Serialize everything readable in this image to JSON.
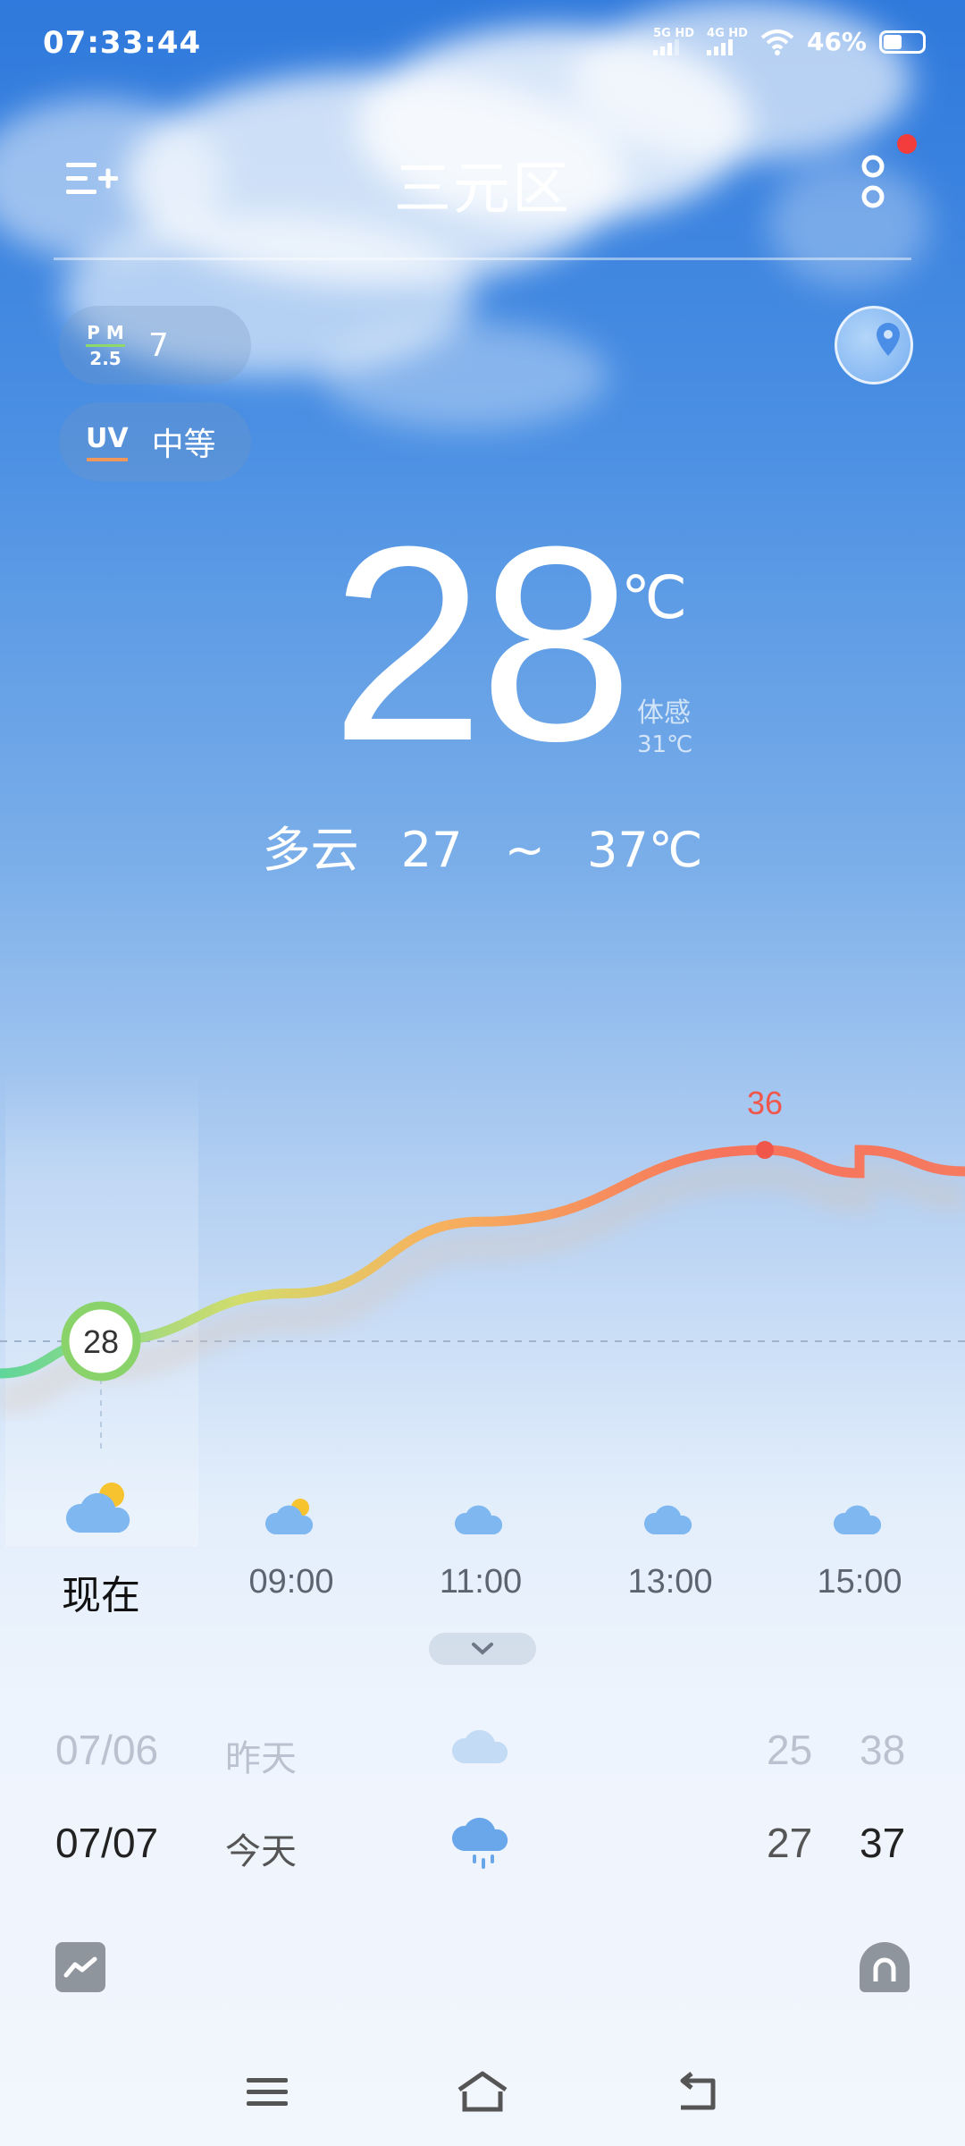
{
  "status_bar": {
    "time": "07:33:44",
    "net1": "5G HD",
    "net2": "4G HD",
    "battery": "46%",
    "battery_level": 0.46
  },
  "header": {
    "city": "三元区"
  },
  "chips": {
    "pm_top": "P M",
    "pm_bottom": "2.5",
    "pm_value": "7",
    "uv_label": "UV",
    "uv_value": "中等"
  },
  "current": {
    "temp": "28",
    "unit": "℃",
    "feels_label": "体感",
    "feels_value": "31℃",
    "condition": "多云",
    "range": "27 ~ 37℃"
  },
  "chart_data": {
    "type": "line",
    "x": [
      "现在",
      "09:00",
      "11:00",
      "13:00",
      "15:00"
    ],
    "series": [
      {
        "values": [
          28,
          30,
          33,
          35,
          36
        ]
      }
    ],
    "current_label": "28",
    "max_label": "36"
  },
  "hourly": [
    {
      "label": "现在",
      "icon": "partly-cloudy-icon"
    },
    {
      "label": "09:00",
      "icon": "partly-cloudy-icon"
    },
    {
      "label": "11:00",
      "icon": "cloud-icon"
    },
    {
      "label": "13:00",
      "icon": "cloud-icon"
    },
    {
      "label": "15:00",
      "icon": "cloud-icon"
    }
  ],
  "daily": [
    {
      "date": "07/06",
      "name": "昨天",
      "icon": "cloud-icon",
      "low": "25",
      "high": "38"
    },
    {
      "date": "07/07",
      "name": "今天",
      "icon": "rain-icon",
      "low": "27",
      "high": "37"
    }
  ],
  "colors": {
    "sky_top": "#2f79dc",
    "curve_start": "#6ad89a",
    "curve_end": "#f2705c",
    "max_point": "#f0564a"
  }
}
